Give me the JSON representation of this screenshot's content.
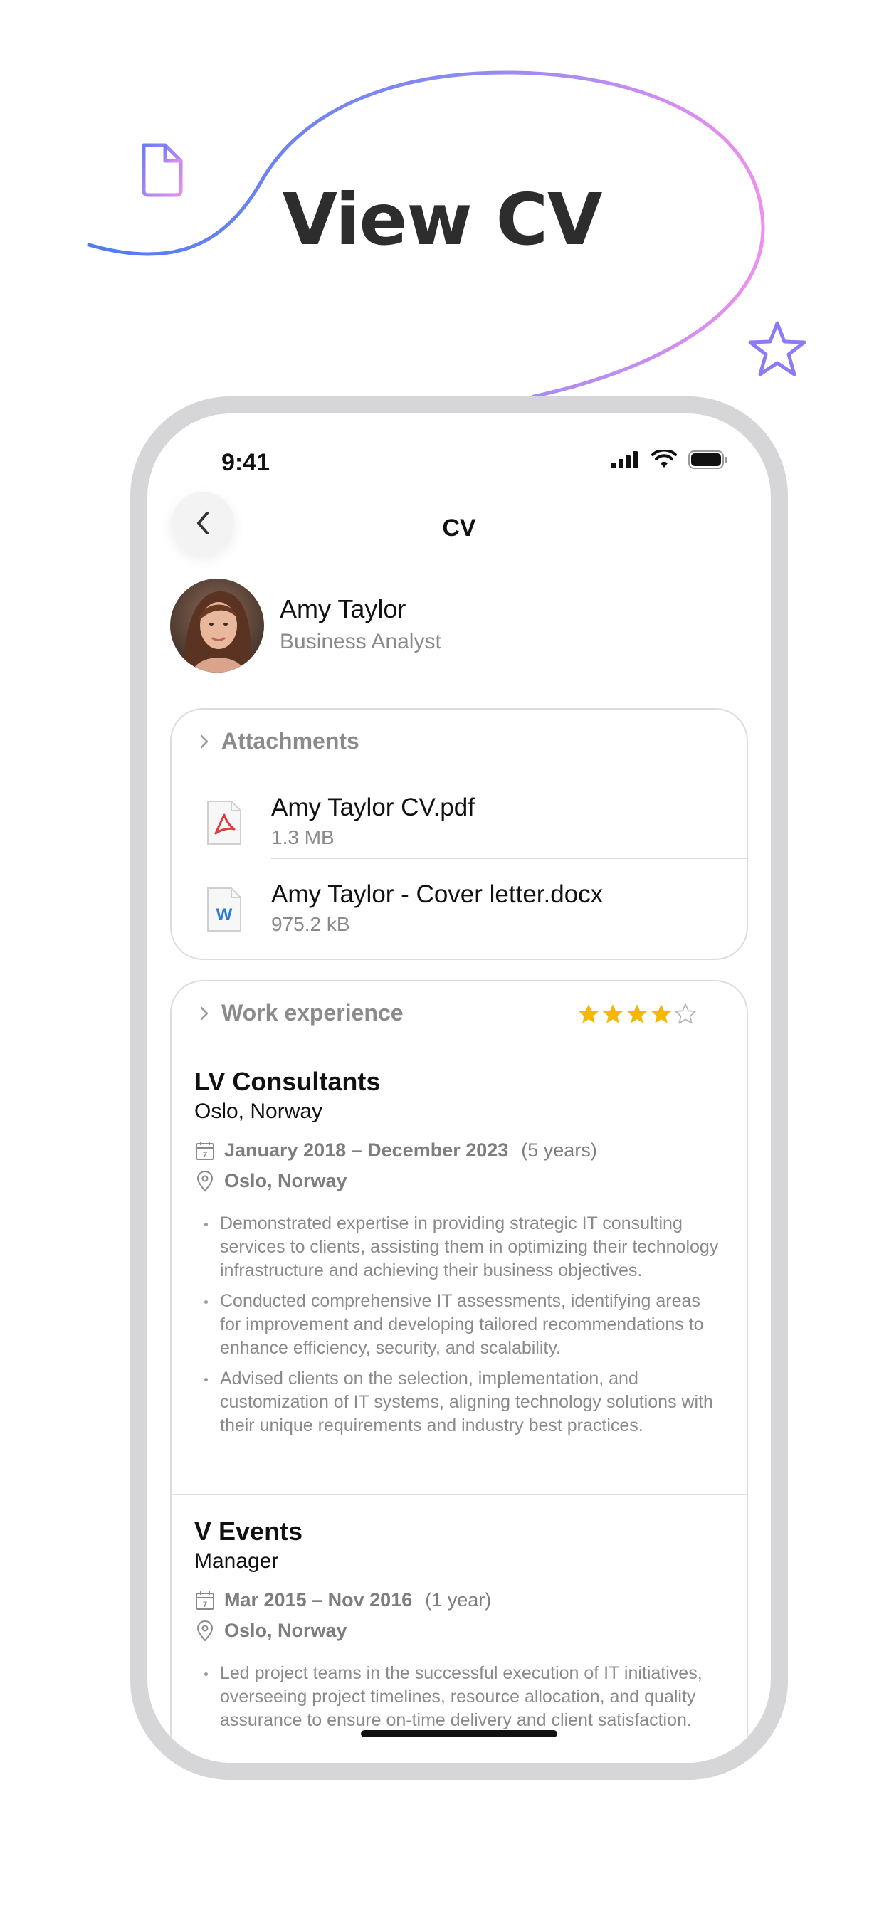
{
  "hero": {
    "title": "View CV"
  },
  "status_bar": {
    "time": "9:41"
  },
  "nav": {
    "title": "CV"
  },
  "profile": {
    "name": "Amy Taylor",
    "role": "Business Analyst"
  },
  "attachments": {
    "title": "Attachments",
    "files": [
      {
        "name": "Amy Taylor CV.pdf",
        "size": "1.3 MB",
        "icon": "pdf-file-icon",
        "icon_color": "#e0393e"
      },
      {
        "name": "Amy Taylor - Cover letter.docx",
        "size": "975.2 kB",
        "icon": "word-file-icon",
        "icon_color": "#2b7cd3"
      }
    ]
  },
  "work_experience": {
    "title": "Work experience",
    "rating": 4,
    "rating_max": 5,
    "star_color": "#f5b800",
    "jobs": [
      {
        "company": "LV Consultants",
        "subtitle": "Oslo, Norway",
        "dates": "January 2018 – December 2023",
        "duration": "(5 years)",
        "location": "Oslo, Norway",
        "bullets": [
          "Demonstrated expertise in providing strategic IT consulting services to clients, assisting them in optimizing their technology infrastructure and achieving their business objectives.",
          "Conducted comprehensive IT assessments, identifying areas for improvement and developing tailored recommendations to enhance efficiency, security, and scalability.",
          "Advised clients on the selection, implementation, and customization of IT systems, aligning technology solutions with their unique requirements and industry best practices."
        ]
      },
      {
        "company": "V Events",
        "subtitle": "Manager",
        "dates": "Mar 2015 – Nov 2016",
        "duration": "(1 year)",
        "location": "Oslo, Norway",
        "bullets": [
          "Led project teams in the successful execution of IT initiatives, overseeing project timelines, resource allocation, and quality assurance to ensure on-time delivery and client satisfaction."
        ]
      }
    ]
  },
  "colors": {
    "accent_blue": "#5b7cf0",
    "accent_pink": "#e98bf0",
    "frame": "#d6d6d8"
  }
}
